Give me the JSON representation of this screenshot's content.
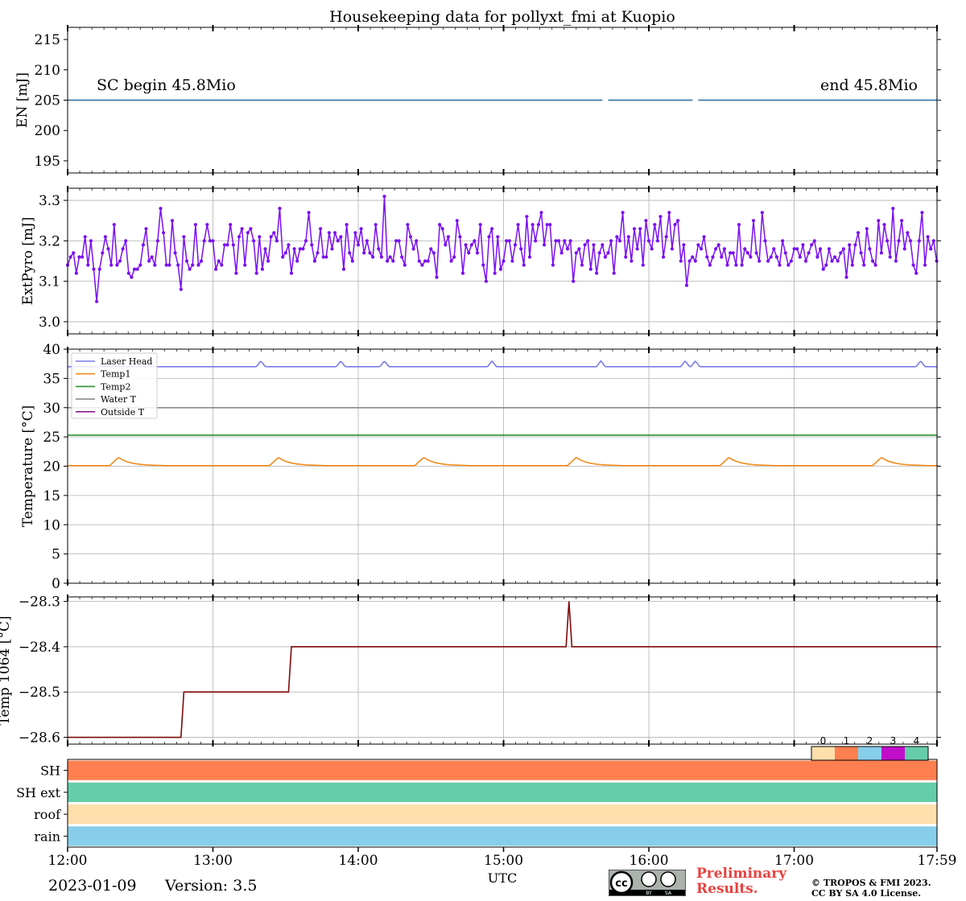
{
  "figure": {
    "title": "Housekeeping data for pollyxt_fmi at Kuopio",
    "date": "2023-01-09",
    "version_label": "Version: 3.5",
    "preliminary": [
      "Preliminary",
      "Results."
    ],
    "copyright": [
      "© TROPOS & FMI 2023.",
      "CC BY SA 4.0 License."
    ],
    "cc_badge": [
      "BY",
      "SA"
    ]
  },
  "chart_data": [
    {
      "type": "line",
      "panel": "energy",
      "ylabel": "EN [mJ]",
      "ylim": [
        193,
        217
      ],
      "yticks": [
        195,
        200,
        205,
        210,
        215
      ],
      "grid": false,
      "annotations": [
        "SC begin 45.8Mio",
        "end 45.8Mio"
      ],
      "series": [
        {
          "color": "#3b7aa6",
          "segments": [
            [
              12.0,
              15.68,
              205
            ],
            [
              15.72,
              16.3,
              205
            ],
            [
              16.34,
              18.0,
              205
            ]
          ]
        }
      ]
    },
    {
      "type": "line",
      "panel": "extpyro",
      "ylabel": "ExtPyro [mJ]",
      "ylim": [
        2.97,
        3.33
      ],
      "yticks": [
        3.0,
        3.1,
        3.2,
        3.3
      ],
      "grid": true,
      "series": [
        {
          "color": "#7b10f0",
          "marker": "dot",
          "x_start": 12.0,
          "x_step": 0.02,
          "values": [
            3.14,
            3.16,
            3.17,
            3.12,
            3.16,
            3.16,
            3.21,
            3.14,
            3.2,
            3.13,
            3.05,
            3.13,
            3.17,
            3.21,
            3.18,
            3.14,
            3.24,
            3.14,
            3.15,
            3.18,
            3.2,
            3.12,
            3.11,
            3.13,
            3.13,
            3.14,
            3.19,
            3.23,
            3.15,
            3.16,
            3.14,
            3.2,
            3.28,
            3.22,
            3.14,
            3.14,
            3.25,
            3.17,
            3.14,
            3.08,
            3.21,
            3.15,
            3.13,
            3.14,
            3.24,
            3.14,
            3.15,
            3.2,
            3.24,
            3.2,
            3.2,
            3.13,
            3.15,
            3.14,
            3.19,
            3.19,
            3.24,
            3.19,
            3.12,
            3.21,
            3.23,
            3.14,
            3.22,
            3.23,
            3.2,
            3.12,
            3.21,
            3.13,
            3.18,
            3.15,
            3.21,
            3.22,
            3.2,
            3.28,
            3.16,
            3.17,
            3.19,
            3.12,
            3.18,
            3.15,
            3.18,
            3.18,
            3.2,
            3.27,
            3.19,
            3.15,
            3.17,
            3.23,
            3.16,
            3.16,
            3.22,
            3.18,
            3.22,
            3.2,
            3.21,
            3.13,
            3.24,
            3.17,
            3.15,
            3.22,
            3.19,
            3.23,
            3.17,
            3.2,
            3.17,
            3.16,
            3.24,
            3.18,
            3.16,
            3.31,
            3.15,
            3.16,
            3.15,
            3.2,
            3.2,
            3.16,
            3.14,
            3.24,
            3.21,
            3.18,
            3.2,
            3.15,
            3.14,
            3.15,
            3.15,
            3.18,
            3.17,
            3.11,
            3.24,
            3.23,
            3.19,
            3.21,
            3.15,
            3.16,
            3.25,
            3.21,
            3.12,
            3.19,
            3.17,
            3.19,
            3.2,
            3.17,
            3.24,
            3.14,
            3.1,
            3.21,
            3.23,
            3.12,
            3.21,
            3.13,
            3.15,
            3.2,
            3.2,
            3.15,
            3.19,
            3.24,
            3.18,
            3.14,
            3.26,
            3.16,
            3.24,
            3.2,
            3.24,
            3.27,
            3.19,
            3.24,
            3.24,
            3.14,
            3.2,
            3.2,
            3.17,
            3.2,
            3.18,
            3.2,
            3.1,
            3.17,
            3.18,
            3.14,
            3.19,
            3.2,
            3.13,
            3.19,
            3.12,
            3.17,
            3.19,
            3.16,
            3.17,
            3.2,
            3.12,
            3.21,
            3.2,
            3.27,
            3.16,
            3.21,
            3.15,
            3.23,
            3.18,
            3.23,
            3.14,
            3.25,
            3.2,
            3.18,
            3.24,
            3.2,
            3.26,
            3.16,
            3.21,
            3.27,
            3.18,
            3.24,
            3.25,
            3.15,
            3.19,
            3.09,
            3.15,
            3.16,
            3.15,
            3.19,
            3.18,
            3.21,
            3.16,
            3.14,
            3.16,
            3.18,
            3.19,
            3.16,
            3.18,
            3.14,
            3.17,
            3.17,
            3.14,
            3.24,
            3.14,
            3.18,
            3.17,
            3.16,
            3.25,
            3.17,
            3.15,
            3.27,
            3.2,
            3.15,
            3.16,
            3.18,
            3.16,
            3.14,
            3.2,
            3.17,
            3.14,
            3.15,
            3.18,
            3.18,
            3.16,
            3.19,
            3.15,
            3.17,
            3.19,
            3.2,
            3.16,
            3.18,
            3.13,
            3.14,
            3.18,
            3.15,
            3.16,
            3.15,
            3.17,
            3.18,
            3.11,
            3.19,
            3.14,
            3.19,
            3.22,
            3.17,
            3.14,
            3.23,
            3.18,
            3.15,
            3.14,
            3.25,
            3.17,
            3.24,
            3.2,
            3.16,
            3.28,
            3.15,
            3.2,
            3.25,
            3.18,
            3.22,
            3.2,
            3.14,
            3.12,
            3.2,
            3.27,
            3.14,
            3.21,
            3.18,
            3.2,
            3.15,
            3.15,
            3.26,
            3.15,
            3.16,
            3.12,
            3.14,
            3.16,
            3.19,
            3.21,
            3.2,
            3.13,
            3.16,
            3.26,
            3.18,
            3.16,
            3.16,
            3.19,
            3.22,
            3.17,
            3.14,
            3.21,
            3.21,
            3.27,
            3.16,
            3.21,
            3.17,
            3.21,
            3.15,
            3.16,
            3.24,
            3.18,
            3.21,
            3.19,
            3.18,
            3.19,
            3.14,
            3.17,
            3.16,
            3.25,
            3.18,
            3.18,
            3.21,
            3.25,
            3.16,
            3.22,
            3.21,
            3.12,
            3.22,
            3.19,
            3.15,
            3.2,
            3.16,
            3.23,
            3.19,
            3.24,
            3.17,
            3.25,
            3.18,
            3.21,
            3.22,
            3.16,
            3.18,
            3.16,
            3.24,
            3.16,
            3.2,
            3.16,
            3.2,
            3.16,
            3.16,
            3.2,
            3.17,
            3.18,
            3.2,
            3.1,
            3.14,
            3.22,
            3.19,
            3.17,
            3.21,
            3.14,
            3.17,
            3.14,
            3.24,
            3.15,
            3.08,
            3.15,
            3.23,
            3.14,
            3.14,
            3.19,
            3.21,
            3.23,
            3.24,
            3.23,
            3.16,
            3.13,
            3.17,
            3.15,
            3.26,
            3.21,
            3.19,
            3.15,
            3.17,
            3.2,
            3.18,
            3.18,
            3.26,
            3.2,
            3.16,
            3.21,
            3.14,
            3.14,
            3.17,
            3.2,
            3.16,
            3.14,
            3.12,
            3.2,
            3.24,
            3.18,
            3.26,
            3.24,
            3.26,
            3.16,
            3.24,
            3.19,
            3.15,
            3.14,
            3.15,
            3.14,
            3.17,
            3.15,
            3.19,
            3.14,
            3.26,
            3.14,
            3.21,
            3.2,
            3.14,
            3.14,
            3.15,
            3.14,
            3.22,
            3.19,
            3.21,
            3.25,
            3.25,
            3.2,
            3.17,
            3.25,
            3.19,
            3.14,
            3.14,
            3.26,
            3.24,
            3.14,
            3.16,
            3.22,
            3.2,
            3.24,
            3.2,
            3.24
          ]
        }
      ]
    },
    {
      "type": "line",
      "panel": "temperatures",
      "ylabel": "Temperature [$^\\circ C$]",
      "ylim": [
        0,
        40
      ],
      "yticks": [
        0,
        5,
        10,
        15,
        20,
        25,
        30,
        35,
        40
      ],
      "grid": true,
      "legend": "upper-left",
      "series": [
        {
          "name": "Laser Head",
          "color": "#7b7bea",
          "base": 37.0,
          "spikes": [
            13.33,
            13.88,
            14.18,
            14.92,
            15.67,
            16.25,
            16.32,
            17.87
          ],
          "spike_height": 1.0
        },
        {
          "name": "Temp1",
          "color": "#f28b1a",
          "base": 20.1,
          "bumps": [
            12.35,
            13.45,
            14.45,
            15.5,
            16.55,
            17.6
          ],
          "bump_height": 1.4
        },
        {
          "name": "Temp2",
          "color": "#2e912e",
          "base": 25.3
        },
        {
          "name": "Water T",
          "color": "#8a8a8a",
          "base": 30.0
        },
        {
          "name": "Outside T",
          "color": "#8a1a8a",
          "base": null
        }
      ]
    },
    {
      "type": "line",
      "panel": "temp1064",
      "ylabel": "Temp 1064 [$^\\circ C$]",
      "ylim": [
        -28.615,
        -28.29
      ],
      "yticks": [
        -28.6,
        -28.5,
        -28.4,
        -28.3
      ],
      "grid": true,
      "series": [
        {
          "color": "#7f0a0a",
          "points": [
            [
              12.0,
              -28.6
            ],
            [
              12.78,
              -28.6
            ],
            [
              12.8,
              -28.5
            ],
            [
              13.52,
              -28.5
            ],
            [
              13.54,
              -28.4
            ],
            [
              15.43,
              -28.4
            ],
            [
              15.45,
              -28.3
            ],
            [
              15.47,
              -28.4
            ],
            [
              17.98,
              -28.4
            ]
          ]
        }
      ]
    },
    {
      "type": "heatmap",
      "panel": "flags",
      "xlabel": "UTC",
      "rows": [
        "SH",
        "SH ext",
        "roof",
        "rain"
      ],
      "row_values": [
        1,
        4,
        0,
        2
      ],
      "colorbar": {
        "ticks": [
          "0",
          "1",
          "2",
          "3",
          "4"
        ],
        "colors": [
          "#ffdfab",
          "#fd7f4f",
          "#87ceeb",
          "#c10eca",
          "#66cdaa"
        ]
      },
      "xlim": [
        12.0,
        17.983
      ],
      "xticks": [
        12,
        13,
        14,
        15,
        16,
        17,
        17.983
      ],
      "xticklabels": [
        "12:00",
        "13:00",
        "14:00",
        "15:00",
        "16:00",
        "17:00",
        "17:59"
      ]
    }
  ]
}
